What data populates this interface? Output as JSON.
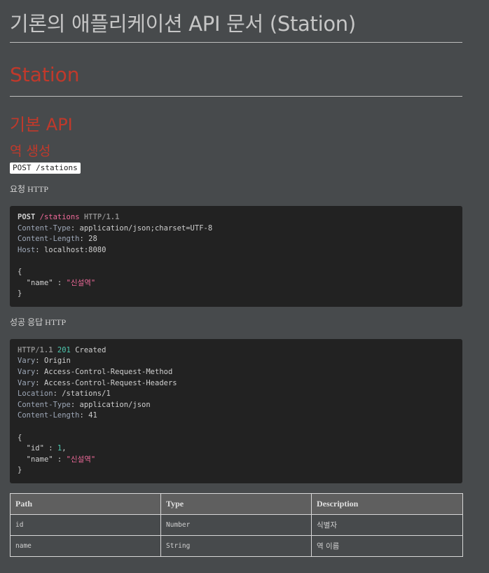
{
  "title": "기론의 애플리케이션 API 문서 (Station)",
  "section": "Station",
  "subsection": "기본 API",
  "operation": {
    "title": "역 생성",
    "endpoint": "POST /stations",
    "request_label": "요청 HTTP",
    "request": {
      "method": "POST",
      "path": "/stations",
      "protocol": "HTTP/1.1",
      "headers": [
        {
          "key": "Content-Type",
          "value": "application/json;charset=UTF-8"
        },
        {
          "key": "Content-Length",
          "value": "28"
        },
        {
          "key": "Host",
          "value": "localhost:8080"
        }
      ],
      "body_open": "{",
      "body_key": "\"name\"",
      "body_sep": " : ",
      "body_value": "\"신설역\"",
      "body_close": "}"
    },
    "response_label": "성공 응답 HTTP",
    "response": {
      "protocol": "HTTP/1.1",
      "status_code": "201",
      "status_text": "Created",
      "headers": [
        {
          "key": "Vary",
          "value": "Origin"
        },
        {
          "key": "Vary",
          "value": "Access-Control-Request-Method"
        },
        {
          "key": "Vary",
          "value": "Access-Control-Request-Headers"
        },
        {
          "key": "Location",
          "value": "/stations/1"
        },
        {
          "key": "Content-Type",
          "value": "application/json"
        },
        {
          "key": "Content-Length",
          "value": "41"
        }
      ],
      "body_open": "{",
      "id_key": "\"id\"",
      "id_sep": " : ",
      "id_value": "1",
      "id_comma": ",",
      "name_key": "\"name\"",
      "name_sep": " : ",
      "name_value": "\"신설역\"",
      "body_close": "}"
    },
    "fields_table": {
      "columns": [
        "Path",
        "Type",
        "Description"
      ],
      "rows": [
        {
          "path": "id",
          "type": "Number",
          "description": "식별자"
        },
        {
          "path": "name",
          "type": "String",
          "description": "역 이름"
        }
      ]
    }
  }
}
